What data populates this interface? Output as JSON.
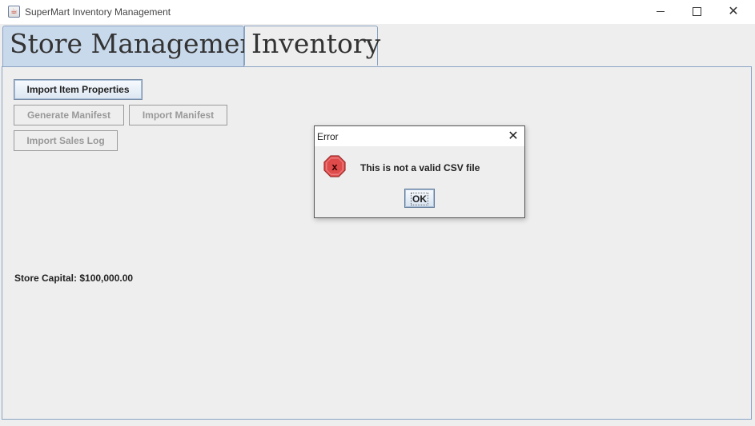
{
  "window": {
    "title": "SuperMart Inventory Management",
    "icons": {
      "app": "java-app-icon",
      "minimize": "minimize-icon",
      "maximize": "maximize-icon",
      "close": "close-icon"
    }
  },
  "tabs": [
    {
      "label": "Store Management",
      "selected": true
    },
    {
      "label": "Inventory",
      "selected": false
    }
  ],
  "store_panel": {
    "buttons": {
      "import_item_properties": {
        "label": "Import Item Properties",
        "enabled": true
      },
      "generate_manifest": {
        "label": "Generate Manifest",
        "enabled": false
      },
      "import_manifest": {
        "label": "Import Manifest",
        "enabled": false
      },
      "import_sales_log": {
        "label": "Import Sales Log",
        "enabled": false
      }
    },
    "store_capital": "Store Capital: $100,000.00"
  },
  "dialog": {
    "title": "Error",
    "message": "This is not a valid CSV file",
    "ok_label": "OK",
    "icon": "error-icon"
  },
  "colors": {
    "selected_tab": "#c9d9ec",
    "tab_border": "#8aa3c4",
    "error_icon_red": "#e45050"
  }
}
